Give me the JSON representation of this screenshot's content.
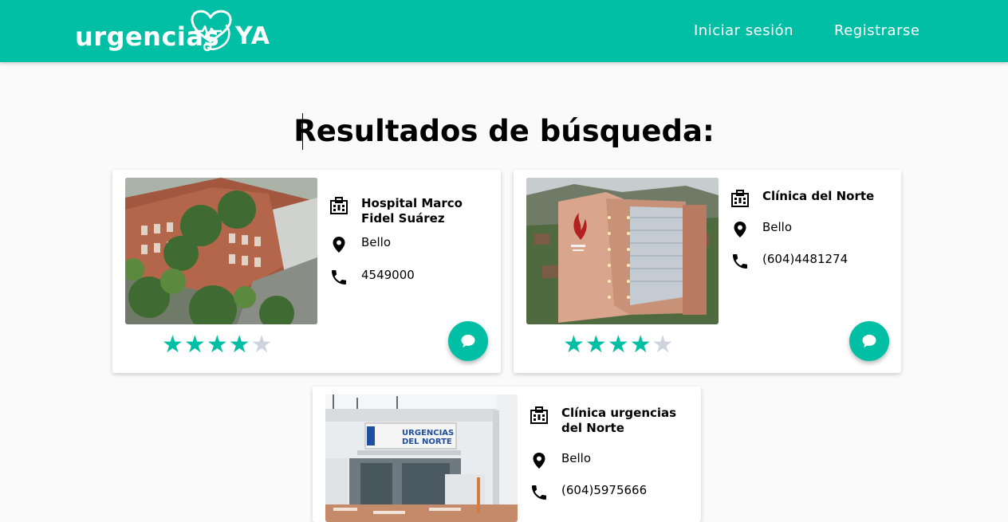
{
  "brand": {
    "word": "urgencias",
    "suffix": "YA"
  },
  "nav": {
    "login": "Iniciar sesión",
    "register": "Registrarse"
  },
  "page": {
    "title": "Resultados de búsqueda:"
  },
  "colors": {
    "primary": "#00bfa5",
    "star_empty": "#cfd3e0"
  },
  "results": [
    {
      "name": "Hospital Marco Fidel Suárez",
      "city": "Bello",
      "phone": "4549000",
      "rating": 4,
      "max_rating": 5
    },
    {
      "name": "Clínica del Norte",
      "city": "Bello",
      "phone": "(604)4481274",
      "rating": 4,
      "max_rating": 5
    },
    {
      "name": "Clínica urgencias del Norte",
      "city": "Bello",
      "phone": "(604)5975666"
    }
  ],
  "photo_signs": {
    "third": [
      "URGENCIAS",
      "DEL NORTE"
    ]
  },
  "icons": {
    "name": "hospital-icon",
    "location": "location-pin-icon",
    "phone": "phone-icon",
    "chat": "chat-icon"
  }
}
